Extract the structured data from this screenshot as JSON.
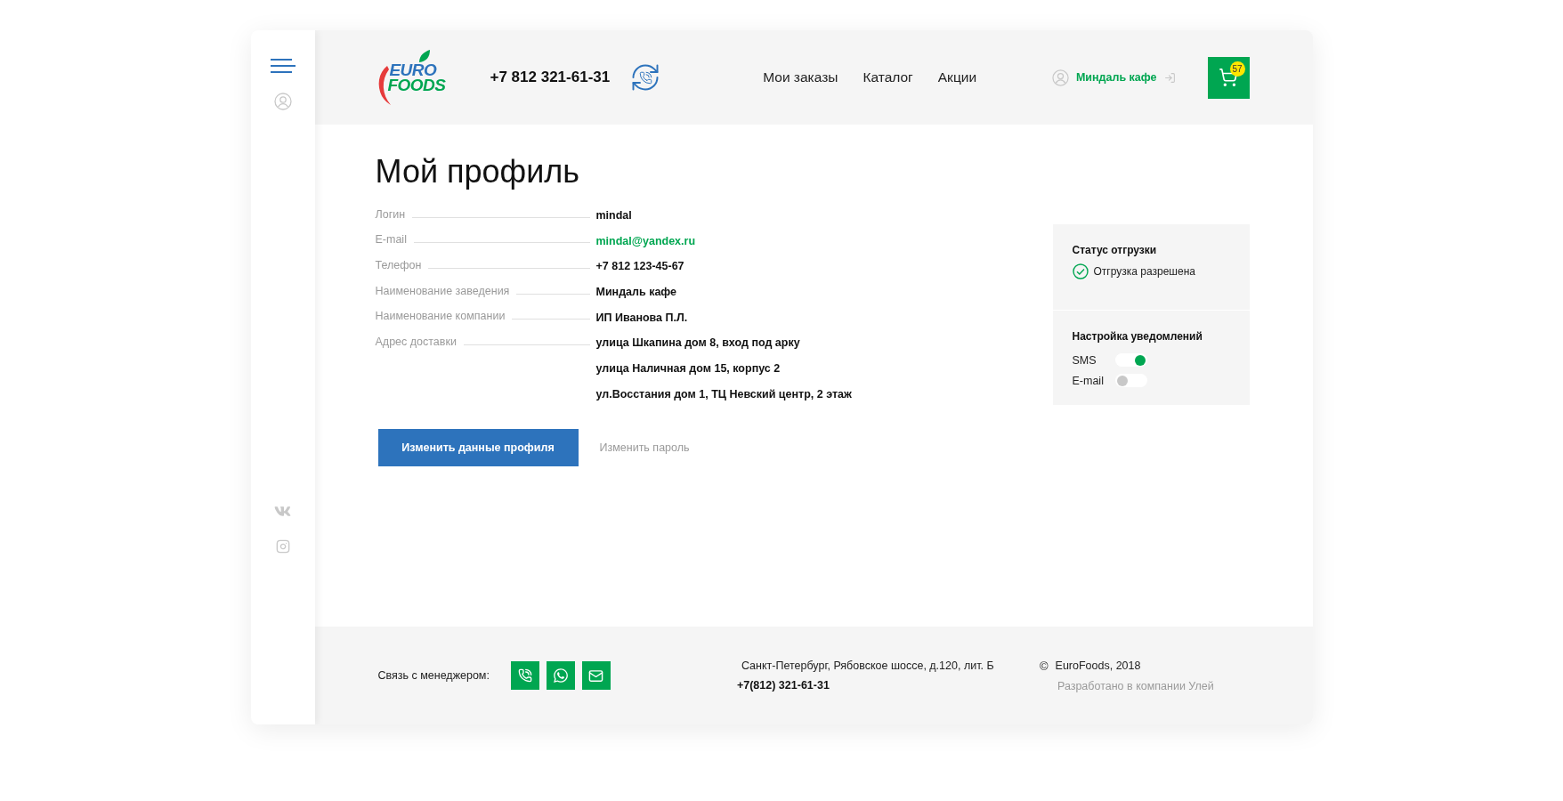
{
  "header": {
    "logo": {
      "line_1": "EURO",
      "line_2": "FOODS"
    },
    "phone": "+7 812 321-61-31",
    "nav": [
      {
        "label": "Мои заказы"
      },
      {
        "label": "Каталог"
      },
      {
        "label": "Акции"
      }
    ],
    "user": {
      "name": "Миндаль кафе"
    },
    "cart": {
      "count": "57"
    }
  },
  "page_title": "Мой профиль",
  "profile_fields": [
    {
      "label": "Логин",
      "kind": "text",
      "values": [
        "mindal"
      ]
    },
    {
      "label": "E-mail",
      "kind": "link",
      "values": [
        "mindal@yandex.ru"
      ]
    },
    {
      "label": "Телефон",
      "kind": "text",
      "values": [
        "+7 812 123-45-67"
      ]
    },
    {
      "label": "Наименование заведения",
      "kind": "text",
      "values": [
        "Миндаль кафе"
      ]
    },
    {
      "label": "Наименование компании",
      "kind": "text",
      "values": [
        "ИП Иванова П.Л."
      ]
    },
    {
      "label": "Адрес доставки",
      "kind": "text",
      "values": [
        "улица Шкапина дом 8, вход под арку",
        "улица Наличная дом 15, корпус 2",
        "ул.Восстания дом 1, ТЦ Невский центр, 2 этаж"
      ]
    }
  ],
  "actions": {
    "primary": "Изменить данные профиля",
    "secondary": "Изменить пароль"
  },
  "side_panel": {
    "shipment": {
      "title": "Статус отгрузки",
      "status": "Отгрузка разрешена",
      "allowed": true
    },
    "notifications": {
      "title": "Настройка уведомлений",
      "items": [
        {
          "label": "SMS",
          "on": true
        },
        {
          "label": "E-mail",
          "on": false
        }
      ]
    }
  },
  "footer": {
    "contact_label": "Связь с менеджером:",
    "address": "Санкт-Петербург, Рябовское шоссе, д.120, лит. Б",
    "phone": "+7(812) 321-61-31",
    "copyright_sign": "©",
    "copyright": "EuroFoods, 2018",
    "developer": "Разработано в компании Улей"
  }
}
